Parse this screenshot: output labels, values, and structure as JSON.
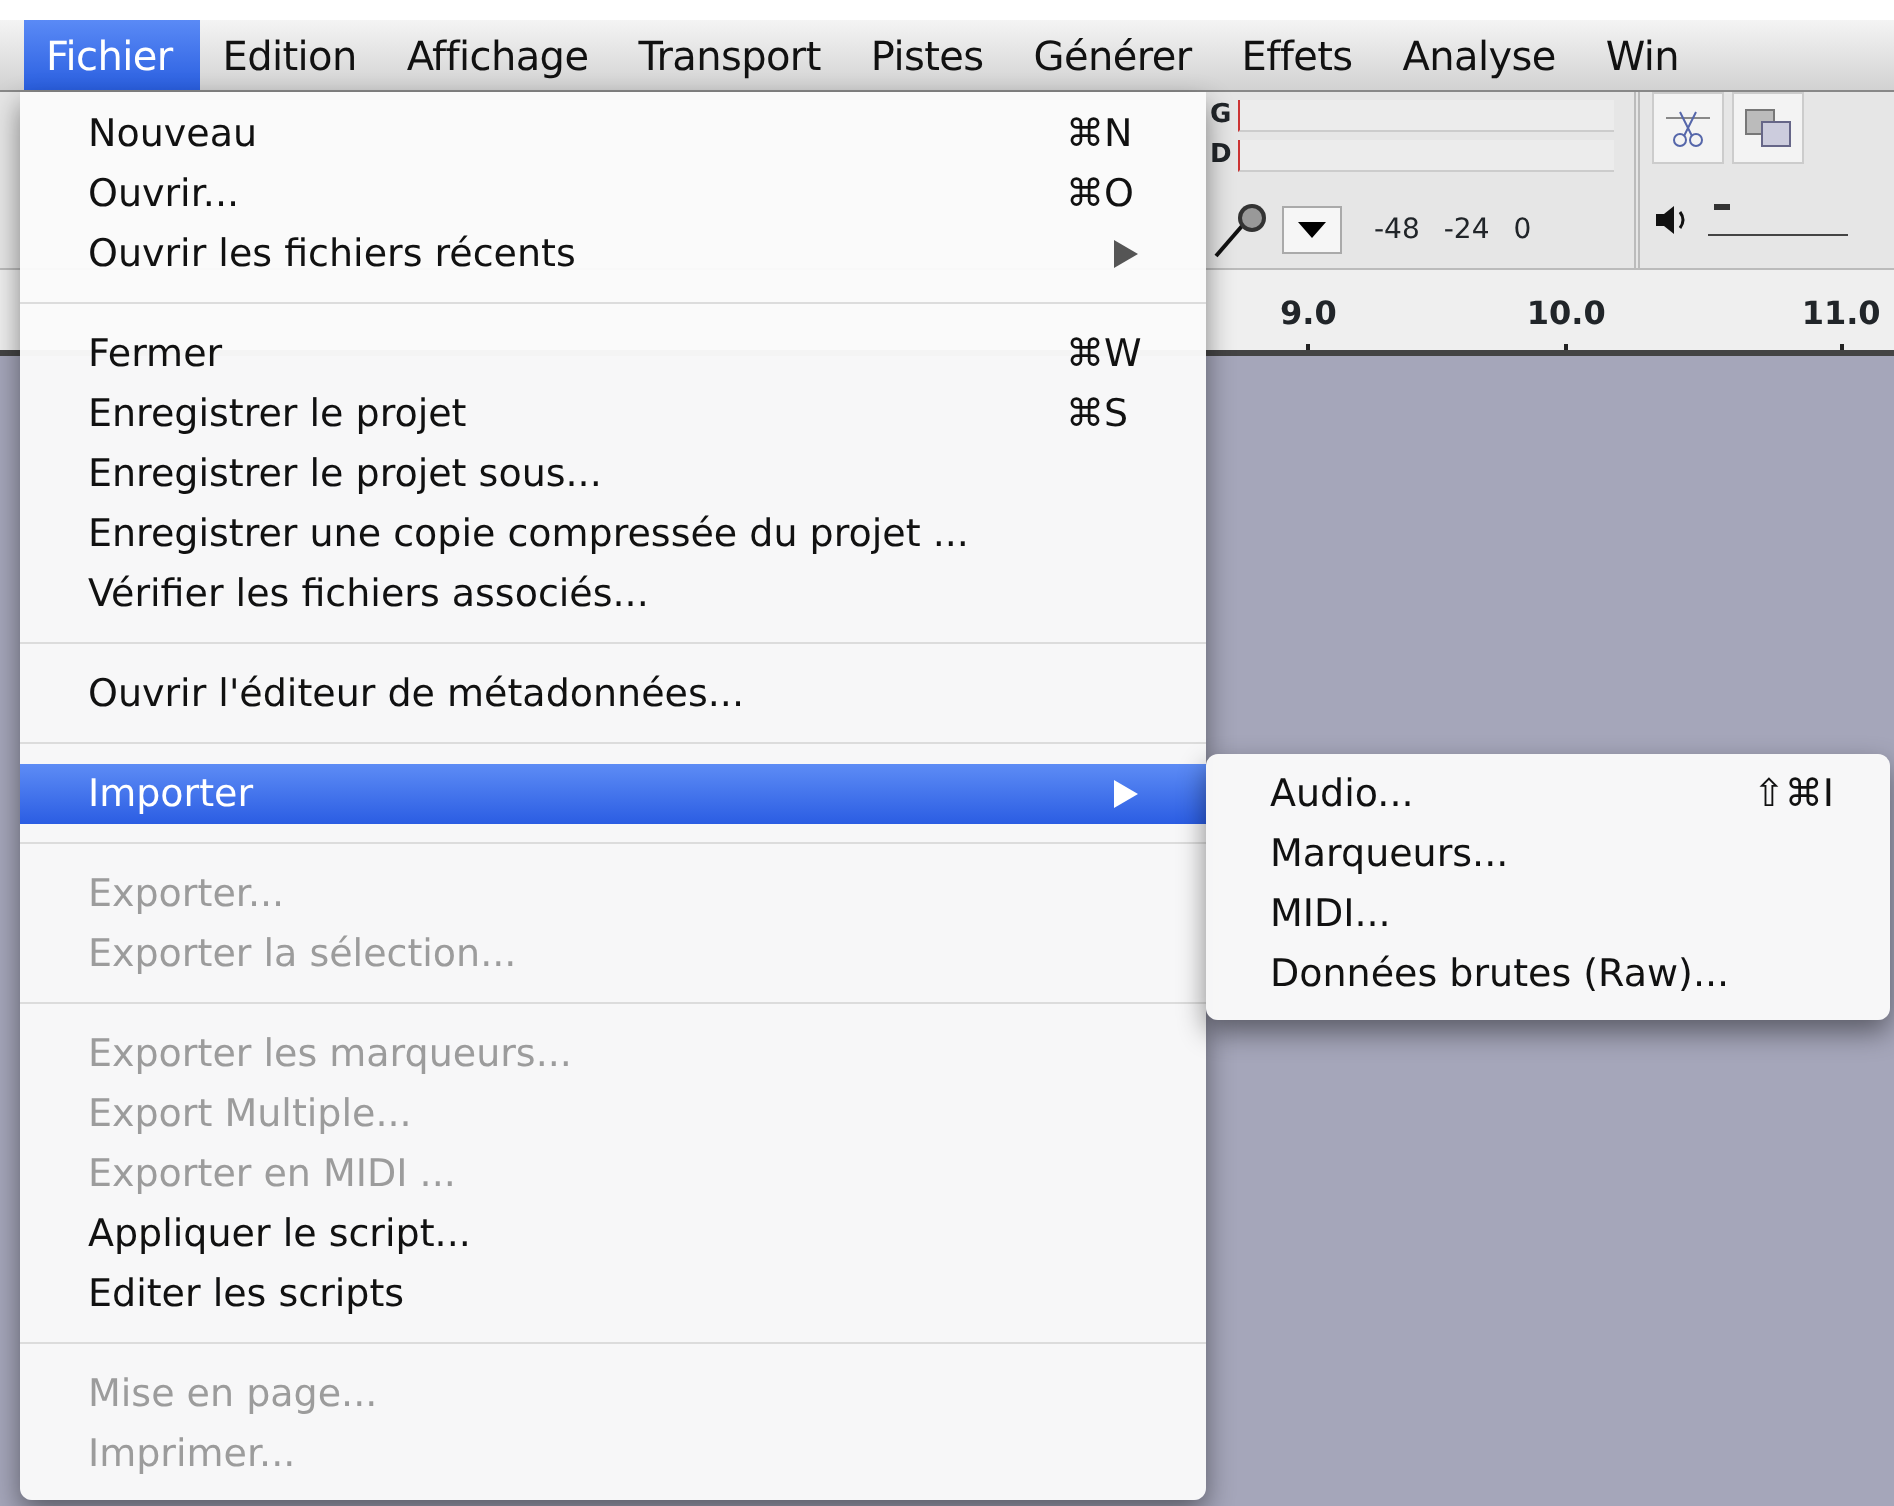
{
  "menubar": [
    {
      "label": "Fichier",
      "selected": true
    },
    {
      "label": "Edition",
      "selected": false
    },
    {
      "label": "Affichage",
      "selected": false
    },
    {
      "label": "Transport",
      "selected": false
    },
    {
      "label": "Pistes",
      "selected": false
    },
    {
      "label": "Générer",
      "selected": false
    },
    {
      "label": "Effets",
      "selected": false
    },
    {
      "label": "Analyse",
      "selected": false
    },
    {
      "label": "Win",
      "selected": false
    }
  ],
  "meter": {
    "channels": [
      "G",
      "D"
    ],
    "scale": [
      "-48",
      "-24",
      "0"
    ]
  },
  "volume": {
    "level": 0.05
  },
  "ruler": {
    "labels": [
      "9.0",
      "10.0",
      "11.0"
    ]
  },
  "menu": {
    "items": [
      {
        "kind": "item",
        "label": "Nouveau",
        "shortcut": "⌘N",
        "disabled": false,
        "selected": false,
        "submenu": false
      },
      {
        "kind": "item",
        "label": "Ouvrir...",
        "shortcut": "⌘O",
        "disabled": false,
        "selected": false,
        "submenu": false
      },
      {
        "kind": "item",
        "label": "Ouvrir les fichiers récents",
        "disabled": false,
        "selected": false,
        "submenu": true
      },
      {
        "kind": "separator"
      },
      {
        "kind": "item",
        "label": "Fermer",
        "shortcut": "⌘W",
        "disabled": false,
        "selected": false,
        "submenu": false
      },
      {
        "kind": "item",
        "label": "Enregistrer le projet",
        "shortcut": "⌘S",
        "disabled": false,
        "selected": false,
        "submenu": false
      },
      {
        "kind": "item",
        "label": "Enregistrer le projet sous...",
        "disabled": false,
        "selected": false,
        "submenu": false
      },
      {
        "kind": "item",
        "label": "Enregistrer une copie compressée du projet ...",
        "disabled": false,
        "selected": false,
        "submenu": false
      },
      {
        "kind": "item",
        "label": "Vérifier les fichiers associés...",
        "disabled": false,
        "selected": false,
        "submenu": false
      },
      {
        "kind": "separator"
      },
      {
        "kind": "item",
        "label": "Ouvrir l'éditeur de métadonnées...",
        "disabled": false,
        "selected": false,
        "submenu": false
      },
      {
        "kind": "separator"
      },
      {
        "kind": "item",
        "label": "Importer",
        "disabled": false,
        "selected": true,
        "submenu": true
      },
      {
        "kind": "separator"
      },
      {
        "kind": "item",
        "label": "Exporter...",
        "disabled": true,
        "selected": false,
        "submenu": false
      },
      {
        "kind": "item",
        "label": "Exporter la sélection...",
        "disabled": true,
        "selected": false,
        "submenu": false
      },
      {
        "kind": "separator"
      },
      {
        "kind": "item",
        "label": "Exporter les marqueurs...",
        "disabled": true,
        "selected": false,
        "submenu": false
      },
      {
        "kind": "item",
        "label": "Export Multiple...",
        "disabled": true,
        "selected": false,
        "submenu": false
      },
      {
        "kind": "item",
        "label": "Exporter en MIDI ...",
        "disabled": true,
        "selected": false,
        "submenu": false
      },
      {
        "kind": "item",
        "label": "Appliquer le script...",
        "disabled": false,
        "selected": false,
        "submenu": false
      },
      {
        "kind": "item",
        "label": "Editer les scripts",
        "disabled": false,
        "selected": false,
        "submenu": false
      },
      {
        "kind": "separator"
      },
      {
        "kind": "item",
        "label": "Mise en page...",
        "disabled": true,
        "selected": false,
        "submenu": false
      },
      {
        "kind": "item",
        "label": "Imprimer...",
        "disabled": true,
        "selected": false,
        "submenu": false
      }
    ]
  },
  "submenu": {
    "items": [
      {
        "label": "Audio...",
        "shortcut": "⇧⌘I",
        "disabled": false,
        "selected": false
      },
      {
        "label": "Marqueurs...",
        "disabled": false,
        "selected": false
      },
      {
        "label": "MIDI...",
        "disabled": false,
        "selected": false
      },
      {
        "label": "Données brutes (Raw)...",
        "disabled": false,
        "selected": false
      }
    ]
  }
}
